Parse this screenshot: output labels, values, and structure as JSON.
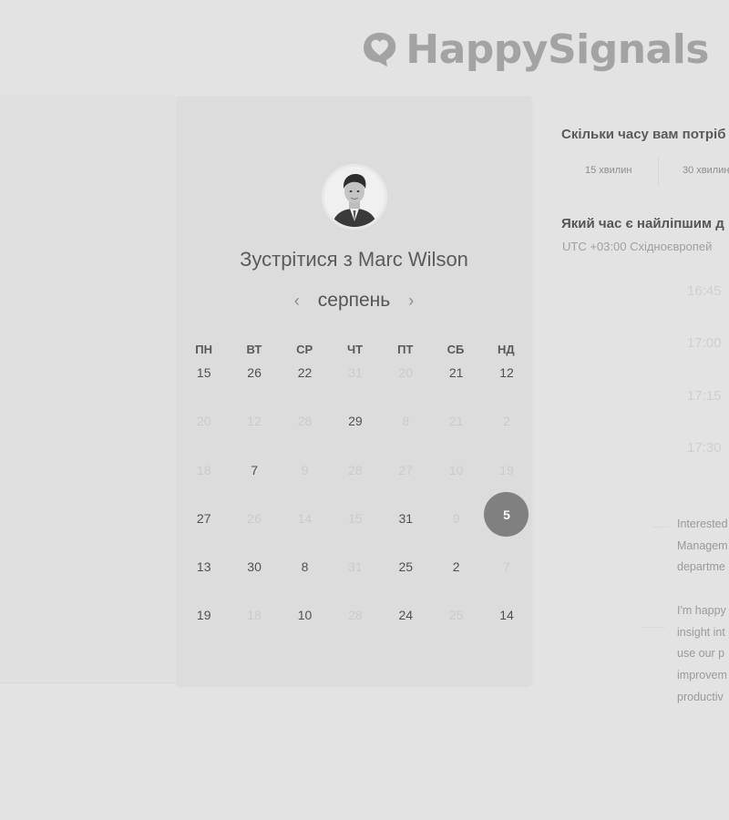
{
  "brand": {
    "name": "HappySignals",
    "color": "#a3a3a3"
  },
  "booking": {
    "title": "Зустрітися з Marc Wilson",
    "avatar_alt": "avatar",
    "month": "серпень",
    "prev_icon": "‹",
    "next_icon": "›",
    "weekdays": [
      "ПН",
      "ВТ",
      "СР",
      "ЧТ",
      "ПТ",
      "СБ",
      "НД"
    ],
    "days": [
      {
        "n": "15",
        "s": "avail"
      },
      {
        "n": "26",
        "s": "avail"
      },
      {
        "n": "22",
        "s": "avail"
      },
      {
        "n": "31",
        "s": "dim"
      },
      {
        "n": "20",
        "s": "dim"
      },
      {
        "n": "21",
        "s": "avail"
      },
      {
        "n": "12",
        "s": "avail"
      },
      {
        "n": "20",
        "s": "dim"
      },
      {
        "n": "12",
        "s": "dim"
      },
      {
        "n": "28",
        "s": "dim"
      },
      {
        "n": "29",
        "s": "avail"
      },
      {
        "n": "8",
        "s": "dim"
      },
      {
        "n": "21",
        "s": "dim"
      },
      {
        "n": "2",
        "s": "dim"
      },
      {
        "n": "18",
        "s": "dim"
      },
      {
        "n": "7",
        "s": "avail"
      },
      {
        "n": "9",
        "s": "dim"
      },
      {
        "n": "28",
        "s": "dim"
      },
      {
        "n": "27",
        "s": "dim"
      },
      {
        "n": "10",
        "s": "dim"
      },
      {
        "n": "19",
        "s": "dim"
      },
      {
        "n": "27",
        "s": "avail"
      },
      {
        "n": "26",
        "s": "dim"
      },
      {
        "n": "14",
        "s": "dim"
      },
      {
        "n": "15",
        "s": "dim"
      },
      {
        "n": "31",
        "s": "avail"
      },
      {
        "n": "9",
        "s": "dim"
      },
      {
        "n": "5",
        "s": "selected"
      },
      {
        "n": "13",
        "s": "avail"
      },
      {
        "n": "30",
        "s": "avail"
      },
      {
        "n": "8",
        "s": "avail"
      },
      {
        "n": "31",
        "s": "dim"
      },
      {
        "n": "25",
        "s": "avail"
      },
      {
        "n": "2",
        "s": "avail"
      },
      {
        "n": "7",
        "s": "dim"
      },
      {
        "n": "19",
        "s": "avail"
      },
      {
        "n": "18",
        "s": "dim"
      },
      {
        "n": "10",
        "s": "avail"
      },
      {
        "n": "28",
        "s": "dim"
      },
      {
        "n": "24",
        "s": "avail"
      },
      {
        "n": "25",
        "s": "dim"
      },
      {
        "n": "14",
        "s": "avail"
      }
    ],
    "selected_color": "#808080"
  },
  "scheduler": {
    "duration_question": "Скільки часу вам потріб",
    "durations": [
      "15 хвилин",
      "30 хвилин"
    ],
    "time_question": "Який час є найліпшим д",
    "timezone": "UTC +03:00 Східноєвропей",
    "slots": [
      "16:45",
      "17:00",
      "17:15",
      "17:30"
    ]
  },
  "description": {
    "para1": [
      "Interested",
      "Managem",
      "departme"
    ],
    "para2": [
      "I'm happy",
      "insight int",
      "use our p",
      "improvem",
      "productiv"
    ]
  }
}
